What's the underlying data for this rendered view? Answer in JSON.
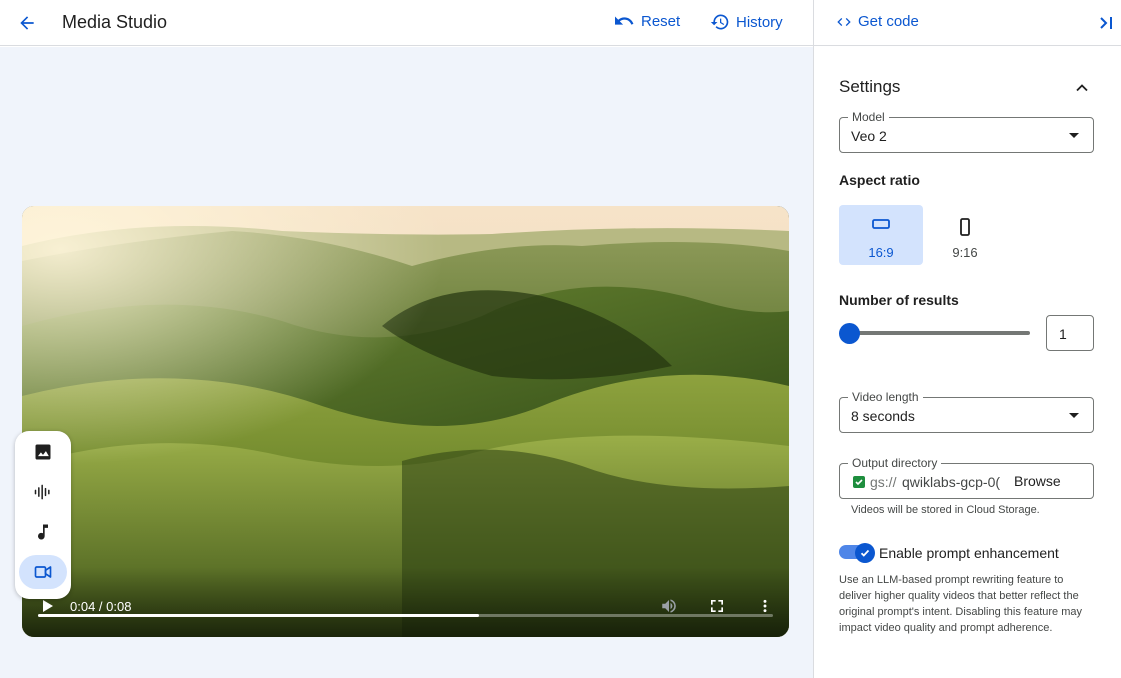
{
  "header": {
    "title": "Media Studio",
    "reset_label": "Reset",
    "history_label": "History"
  },
  "panel": {
    "get_code_label": "Get code",
    "settings_title": "Settings",
    "model": {
      "label": "Model",
      "value": "Veo 2"
    },
    "aspect_ratio": {
      "label": "Aspect ratio",
      "options": [
        {
          "label": "16:9",
          "selected": true
        },
        {
          "label": "9:16",
          "selected": false
        }
      ]
    },
    "results": {
      "label": "Number of results",
      "value": "1"
    },
    "video_length": {
      "label": "Video length",
      "value": "8 seconds"
    },
    "output_dir": {
      "label": "Output directory",
      "prefix": "gs://",
      "value": "qwiklabs-gcp-0(",
      "browse_label": "Browse",
      "helper": "Videos will be stored in Cloud Storage."
    },
    "enhancement": {
      "label": "Enable prompt enhancement",
      "enabled": true,
      "description": "Use an LLM-based prompt rewriting feature to deliver higher quality videos that better reflect the original prompt's intent. Disabling this feature may impact video quality and prompt adherence."
    }
  },
  "video": {
    "time": "0:04 / 0:08",
    "progress": 0.6
  },
  "media_toolbar": [
    {
      "icon": "image-icon",
      "active": false
    },
    {
      "icon": "audio-waveform-icon",
      "active": false
    },
    {
      "icon": "music-note-icon",
      "active": false
    },
    {
      "icon": "video-camera-icon",
      "active": true
    }
  ],
  "colors": {
    "accent": "#0b57d0",
    "accent_light": "#d3e3fd",
    "canvas_bg": "#f0f4fb"
  }
}
